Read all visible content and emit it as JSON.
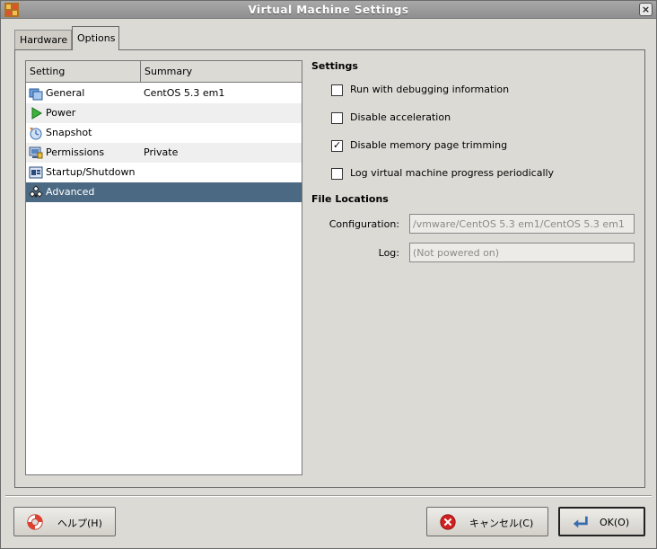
{
  "window": {
    "title": "Virtual Machine Settings"
  },
  "tabs": [
    {
      "label": "Hardware",
      "active": false
    },
    {
      "label": "Options",
      "active": true
    }
  ],
  "settings_list": {
    "headers": {
      "setting": "Setting",
      "summary": "Summary"
    },
    "rows": [
      {
        "name": "General",
        "summary": "CentOS 5.3 em1",
        "icon": "general-icon"
      },
      {
        "name": "Power",
        "summary": "",
        "icon": "power-play-icon"
      },
      {
        "name": "Snapshot",
        "summary": "",
        "icon": "snapshot-icon"
      },
      {
        "name": "Permissions",
        "summary": "Private",
        "icon": "permissions-icon"
      },
      {
        "name": "Startup/Shutdown",
        "summary": "",
        "icon": "startup-shutdown-icon"
      },
      {
        "name": "Advanced",
        "summary": "",
        "icon": "advanced-icon",
        "selected": true
      }
    ]
  },
  "settings_section": {
    "title": "Settings",
    "options": [
      {
        "label": "Run with debugging information",
        "checked": false
      },
      {
        "label": "Disable acceleration",
        "checked": false
      },
      {
        "label": "Disable memory page trimming",
        "checked": true
      },
      {
        "label": "Log virtual machine progress periodically",
        "checked": false
      }
    ]
  },
  "file_locations": {
    "title": "File Locations",
    "configuration_label": "Configuration:",
    "configuration_value": "/vmware/CentOS 5.3 em1/CentOS 5.3 em1",
    "log_label": "Log:",
    "log_value": "(Not powered on)"
  },
  "buttons": {
    "help": "ヘルプ(H)",
    "cancel": "キャンセル(C)",
    "ok": "OK(O)"
  },
  "colors": {
    "selection": "#4b6983",
    "panel": "#dcdad5"
  }
}
